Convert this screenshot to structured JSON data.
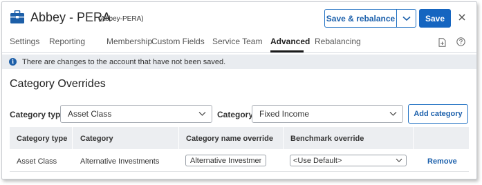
{
  "header": {
    "account_name": "Abbey - PERA",
    "account_subtitle": "(Abbey-PERA)",
    "save_rebalance_label": "Save & rebalance",
    "save_label": "Save"
  },
  "tabs": [
    {
      "label": "Settings"
    },
    {
      "label": "Reporting"
    },
    {
      "label": "Membership"
    },
    {
      "label": "Custom Fields"
    },
    {
      "label": "Service Team"
    },
    {
      "label": "Advanced",
      "active": true
    },
    {
      "label": "Rebalancing"
    }
  ],
  "alert": {
    "message": "There are changes to the account that have not been saved."
  },
  "section": {
    "title": "Category Overrides"
  },
  "filters": {
    "category_type_label": "Category type",
    "category_type_value": "Asset Class",
    "category_label": "Category",
    "category_value": "Fixed Income",
    "add_category_label": "Add category"
  },
  "table": {
    "columns": [
      "Category type",
      "Category",
      "Category name override",
      "Benchmark override"
    ],
    "rows": [
      {
        "category_type": "Asset Class",
        "category": "Alternative Investments",
        "name_override": "Alternative Investment",
        "benchmark_override": "<Use Default>",
        "action": "Remove"
      }
    ]
  },
  "colors": {
    "accent": "#1565c0",
    "link": "#1a5fab",
    "header_bg": "#eceef1",
    "alert_bg": "#e9ecf0"
  },
  "icons": [
    "briefcase-icon",
    "chevron-down-icon",
    "close-icon",
    "document-add-icon",
    "help-icon",
    "info-icon"
  ]
}
